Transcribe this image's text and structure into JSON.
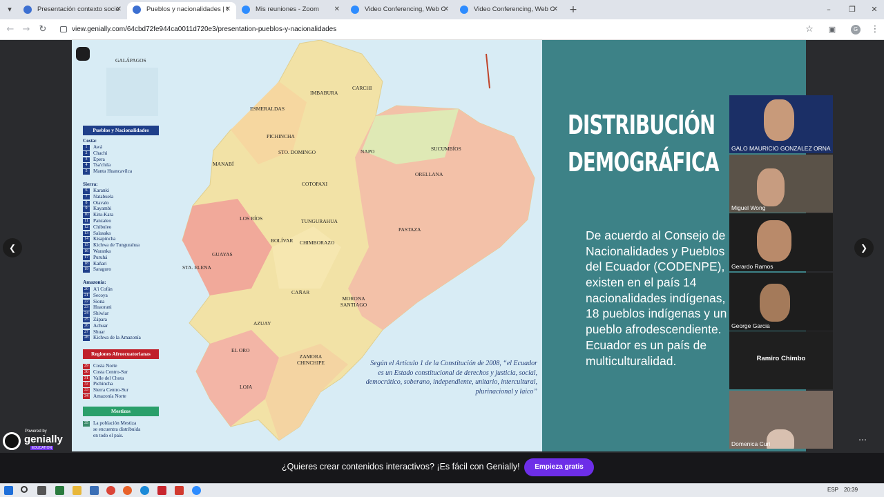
{
  "browser": {
    "tabs": [
      {
        "label": "Presentación contexto socioec",
        "active": false,
        "icon_color": "#3c6fd1"
      },
      {
        "label": "Pueblos y nacionalidades | Gen",
        "active": true,
        "icon_color": "#3c6fd1"
      },
      {
        "label": "Mis reuniones - Zoom",
        "active": false,
        "icon_color": "#2d8cff"
      },
      {
        "label": "Video Conferencing, Web Confe",
        "active": false,
        "icon_color": "#2d8cff"
      },
      {
        "label": "Video Conferencing, Web Confe",
        "active": false,
        "icon_color": "#2d8cff"
      }
    ],
    "new_tab": "+",
    "url": "view.genially.com/64cbd72fe944ca0011d720e3/presentation-pueblos-y-nacionalidades"
  },
  "map": {
    "region_label": "GALÁPAGOS",
    "legend_title": "Pueblos y Nacionalidades",
    "costa_title": "Costa:",
    "costa": [
      [
        "1",
        "Awá"
      ],
      [
        "2",
        "Chachi"
      ],
      [
        "3",
        "Epera"
      ],
      [
        "4",
        "Tsa'chila"
      ],
      [
        "5",
        "Manta Huancavilca"
      ]
    ],
    "sierra_title": "Sierra:",
    "sierra": [
      [
        "6",
        "Karanki"
      ],
      [
        "7",
        "Natabuela"
      ],
      [
        "8",
        "Otavalo"
      ],
      [
        "9",
        "Kayambi"
      ],
      [
        "10",
        "Kitu-Kara"
      ],
      [
        "11",
        "Panzaleo"
      ],
      [
        "12",
        "Chibuleo"
      ],
      [
        "13",
        "Salasaka"
      ],
      [
        "14",
        "Kisapincha"
      ],
      [
        "15",
        "Kichwa de Tungurahua"
      ],
      [
        "16",
        "Waranka"
      ],
      [
        "17",
        "Puruhá"
      ],
      [
        "18",
        "Kañari"
      ],
      [
        "19",
        "Saraguro"
      ]
    ],
    "amazonia_title": "Amazonía:",
    "amazonia": [
      [
        "20",
        "A'i Cofán"
      ],
      [
        "21",
        "Secoya"
      ],
      [
        "22",
        "Siona"
      ],
      [
        "23",
        "Huaorani"
      ],
      [
        "24",
        "Shiwiar"
      ],
      [
        "25",
        "Zápara"
      ],
      [
        "26",
        "Achuar"
      ],
      [
        "27",
        "Shuar"
      ],
      [
        "28",
        "Kichwa de la Amazonía"
      ]
    ],
    "afro_title": "Regiones Afroecuatorianas",
    "afro": [
      [
        "29",
        "Costa Norte"
      ],
      [
        "30",
        "Costa Centro-Sur"
      ],
      [
        "31",
        "Valle del Chota"
      ],
      [
        "32",
        "Pichincha"
      ],
      [
        "33",
        "Sierra Centro-Sur"
      ],
      [
        "34",
        "Amazonía Norte"
      ]
    ],
    "mestizo_title": "Mestizos",
    "mestizo_num": "35",
    "mestizo_text": [
      "La población Mestiza",
      "se encuentra distribuida",
      "en todo el país."
    ],
    "places": [
      "ESMERALDAS",
      "IMBABURA",
      "CARCHI",
      "PICHINCHA",
      "STO. DOMINGO",
      "NAPO",
      "SUCUMBÍOS",
      "MANABÍ",
      "ORELLANA",
      "COTOPAXI",
      "LOS RÍOS",
      "TUNGURAHUA",
      "PASTAZA",
      "BOLÍVAR",
      "CHIMBORAZO",
      "GUAYAS",
      "STA. ELENA",
      "CAÑAR",
      "MORONA SANTIAGO",
      "AZUAY",
      "EL ORO",
      "ZAMORA CHINCHIPE",
      "LOJA"
    ],
    "quote": [
      "Según el Artículo 1 de la Constitución de 2008, “el Ecuador",
      "es un Estado constitucional de derechos y justicia, social,",
      "democrático, soberano, independiente, unitario, intercultural,",
      "plurinacional y laico”"
    ]
  },
  "slide": {
    "heading_lines": [
      "DISTRIBUCIÓN",
      "DEMOGRÁFICA"
    ],
    "body_lines": [
      "De acuerdo al Consejo de",
      "Nacionalidades y Pueblos",
      "del Ecuador (CODENPE),",
      "existen en el país 14",
      "nacionalidades indígenas,",
      "18 pueblos indígenas y un",
      "pueblo afrodescendiente.",
      "Ecuador es un país de",
      "multiculturalidad."
    ]
  },
  "participants": [
    {
      "name": "GALO MAURICIO GONZALEZ ORNA",
      "video": true
    },
    {
      "name": "Miguel Wong",
      "video": true
    },
    {
      "name": "Gerardo Ramos",
      "video": true
    },
    {
      "name": "George Garcia",
      "video": true
    },
    {
      "name": "Ramiro Chimbo",
      "video": false
    },
    {
      "name": "Domenica Curi",
      "video": true
    }
  ],
  "cta": {
    "message": "¿Quieres crear contenidos interactivos? ¡Es fácil con Genially!",
    "button": "Empieza gratis"
  },
  "genially": {
    "powered": "Powered by",
    "brand": "genially",
    "edition": "EDUCATION"
  },
  "taskbar": {
    "lang": "ESP",
    "time": "20:39"
  }
}
